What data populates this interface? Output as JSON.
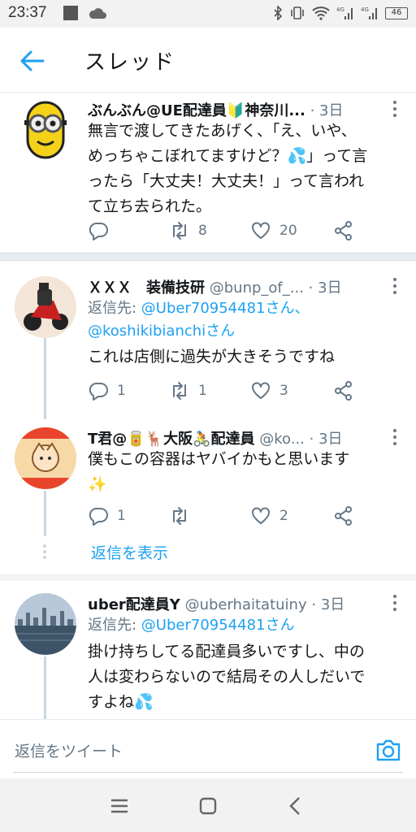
{
  "status_bar": {
    "time": "23:37",
    "battery": "46"
  },
  "header": {
    "title": "スレッド"
  },
  "colors": {
    "accent": "#1da1f2",
    "muted": "#657786",
    "text": "#14171a"
  },
  "tweets": [
    {
      "name": "ぶんぶん@UE配達員🔰神奈川...",
      "handle": "",
      "dot": "·",
      "time": "3日",
      "reply_to": null,
      "lines": [
        "無言で渡してきたあげく、「え、いや、",
        "めっちゃこぼれてますけど？💦」って言",
        "ったら「大丈夫！大丈夫！」って言われ",
        "て立ち去られた。"
      ],
      "counts": {
        "reply": "",
        "retweet": "8",
        "like": "20"
      }
    },
    {
      "name": "ＸＸＸ　装備技研",
      "handle": "@bunp_of_...",
      "dot": "·",
      "time": "3日",
      "reply_prefix": "返信先: ",
      "reply_line1": "@Uber70954481さん、",
      "reply_line2": "@koshikibianchiさん",
      "lines": [
        "これは店側に過失が大きそうですね"
      ],
      "counts": {
        "reply": "1",
        "retweet": "1",
        "like": "3"
      }
    },
    {
      "name": "T君@🥫🦌大阪🚴配達員",
      "handle": "@ko...",
      "dot": "·",
      "time": "3日",
      "lines": [
        "僕もこの容器はヤバイかもと思います",
        "✨"
      ],
      "counts": {
        "reply": "1",
        "retweet": "",
        "like": "2"
      }
    },
    {
      "name": "uber配達員Y",
      "handle": "@uberhaitatuiny",
      "dot": "·",
      "time": "3日",
      "reply_prefix": "返信先: ",
      "reply_line1": "@Uber70954481さん",
      "lines": [
        "掛け持ちしてる配達員多いですし、中の",
        "人は変わらないので結局その人しだいで",
        "すよね💦"
      ]
    }
  ],
  "show_replies": "返信を表示",
  "compose": {
    "placeholder": "返信をツイート"
  },
  "icons": [
    "back-arrow-icon",
    "reply-icon",
    "retweet-icon",
    "like-icon",
    "share-icon",
    "more-icon",
    "camera-icon",
    "menu-icon",
    "home-icon",
    "back-icon"
  ]
}
